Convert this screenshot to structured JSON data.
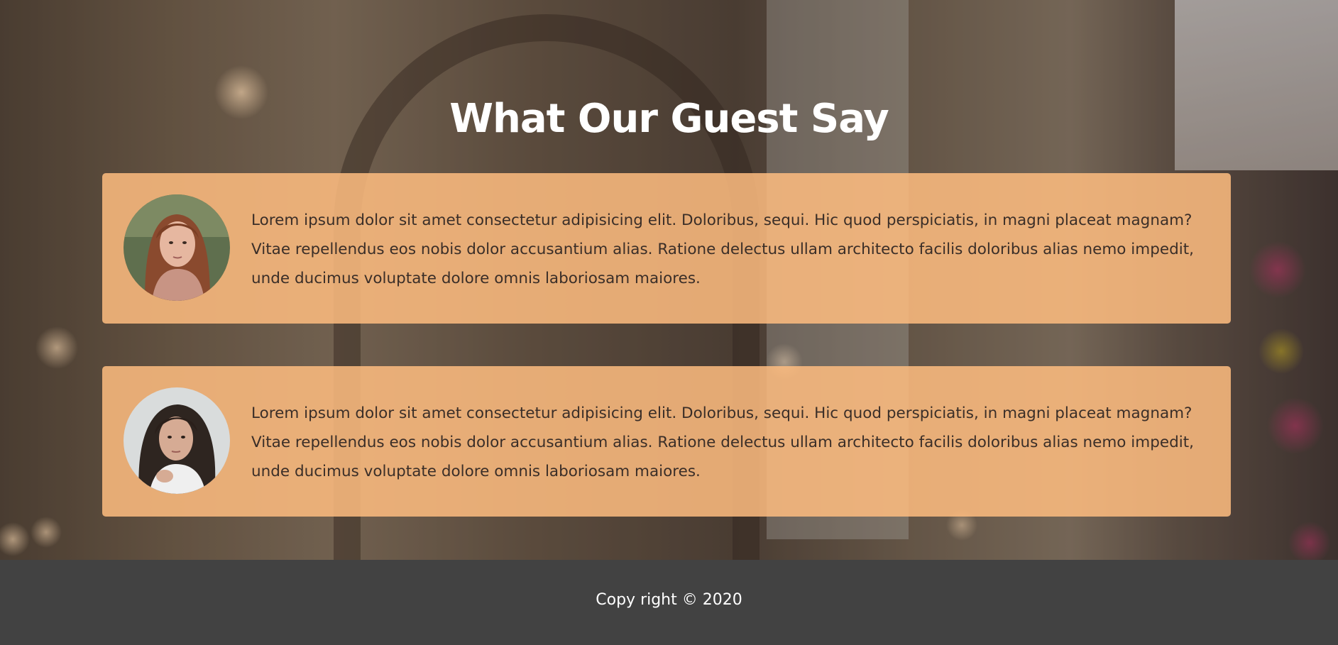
{
  "testimonials": {
    "heading": "What Our Guest Say",
    "items": [
      {
        "avatar_icon": "woman-portrait-avatar",
        "text": "Lorem ipsum dolor sit amet consectetur adipisicing elit. Doloribus, sequi. Hic quod perspiciatis, in magni placeat magnam? Vitae repellendus eos nobis dolor accusantium alias. Ratione delectus ullam architecto facilis doloribus alias nemo impedit, unde ducimus voluptate dolore omnis laboriosam maiores."
      },
      {
        "avatar_icon": "woman-portrait-avatar",
        "text": "Lorem ipsum dolor sit amet consectetur adipisicing elit. Doloribus, sequi. Hic quod perspiciatis, in magni placeat magnam? Vitae repellendus eos nobis dolor accusantium alias. Ratione delectus ullam architecto facilis doloribus alias nemo impedit, unde ducimus voluptate dolore omnis laboriosam maiores."
      }
    ]
  },
  "footer": {
    "copyright": "Copy right © 2020"
  },
  "colors": {
    "card_background": "#ffbd80",
    "footer_background": "#424242",
    "heading_text": "#ffffff",
    "card_text": "#3a2e28"
  }
}
